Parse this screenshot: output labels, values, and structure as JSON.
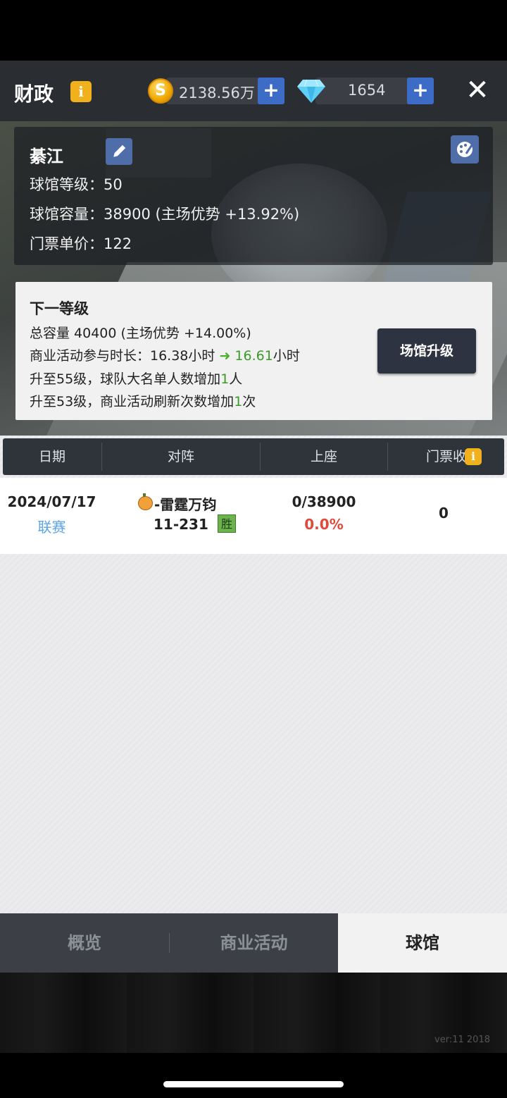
{
  "header": {
    "title": "财政",
    "info_icon": "i",
    "coins": "2138.56万",
    "gems": "1654",
    "plus": "+",
    "close": "✕"
  },
  "stadium": {
    "name": "綦江",
    "level_label": "球馆等级：",
    "level_value": "50",
    "capacity_label": "球馆容量：",
    "capacity_value": "38900 (主场优势 +13.92%)",
    "ticket_label": "门票单价：",
    "ticket_value": "122"
  },
  "next_level": {
    "title": "下一等级",
    "capacity_line": "总容量  40400 (主场优势 +14.00%)",
    "duration_prefix": "商业活动参与时长：16.38小时",
    "duration_new": "16.61",
    "duration_suffix": "小时",
    "line3_prefix": "升至55级，球队大名单人数增加",
    "line3_num": "1",
    "line3_suffix": "人",
    "line4_prefix": "升至53级，商业活动刷新次数增加",
    "line4_num": "1",
    "line4_suffix": "次",
    "upgrade_button": "场馆升级"
  },
  "table": {
    "headers": [
      "日期",
      "对阵",
      "上座",
      "门票收入"
    ],
    "rows": [
      {
        "date": "2024/07/17",
        "type": "联赛",
        "opponent": "-雷霆万钧",
        "score": "11-231",
        "result": "胜",
        "attendance": "0/38900",
        "attendance_pct": "0.0%",
        "revenue": "0"
      }
    ]
  },
  "nav": {
    "tabs": [
      "概览",
      "商业活动",
      "球馆"
    ],
    "active": "球馆"
  },
  "footer": {
    "version": "ver:11  2018"
  },
  "colors": {
    "accent_blue": "#3c6cc6",
    "gold": "#f1b11d",
    "green": "#3b9a2a",
    "red": "#e04a3a"
  }
}
